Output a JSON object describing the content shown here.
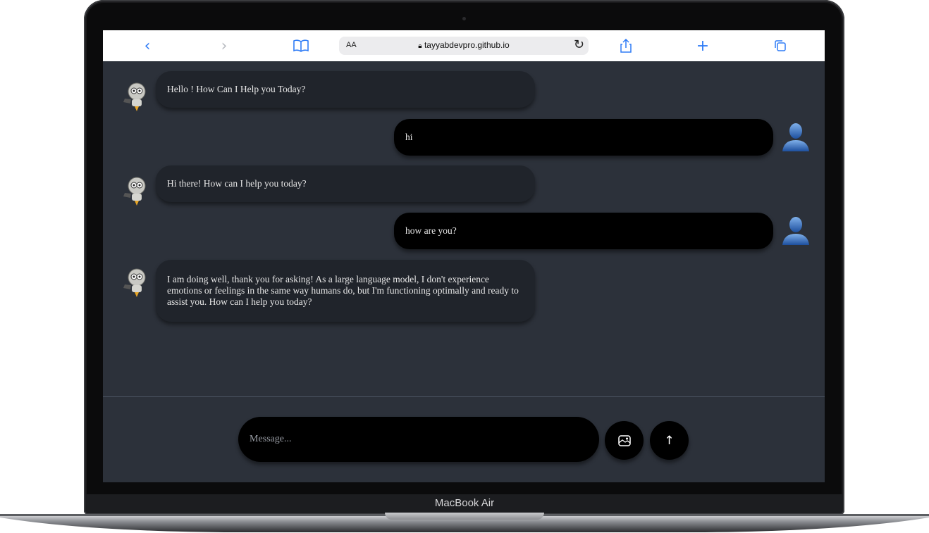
{
  "device": {
    "label": "MacBook Air"
  },
  "browser": {
    "text_size_label": "AA",
    "url": "tayyabdevpro.github.io",
    "icons": [
      "back-icon",
      "forward-icon",
      "bookmarks-icon",
      "lock-icon",
      "reload-icon",
      "share-icon",
      "new-tab-icon",
      "tabs-icon"
    ]
  },
  "chat": {
    "messages": [
      {
        "role": "bot",
        "text": "Hello ! How Can I Help you Today?"
      },
      {
        "role": "user",
        "text": "hi"
      },
      {
        "role": "bot",
        "text": "Hi there! How can I help you today?"
      },
      {
        "role": "user",
        "text": "how are you?"
      },
      {
        "role": "bot",
        "text": "I am doing well, thank you for asking! As a large language model, I don't experience emotions or feelings in the same way humans do, but I'm functioning optimally and ready to assist you. How can I help you today?"
      }
    ]
  },
  "composer": {
    "placeholder": "Message...",
    "buttons": [
      "image-upload-icon",
      "send-arrow-icon"
    ]
  },
  "colors": {
    "background": "#2c313a",
    "bot_bubble": "#20242b",
    "user_bubble": "#000000",
    "accent": "#2f7cf6"
  }
}
